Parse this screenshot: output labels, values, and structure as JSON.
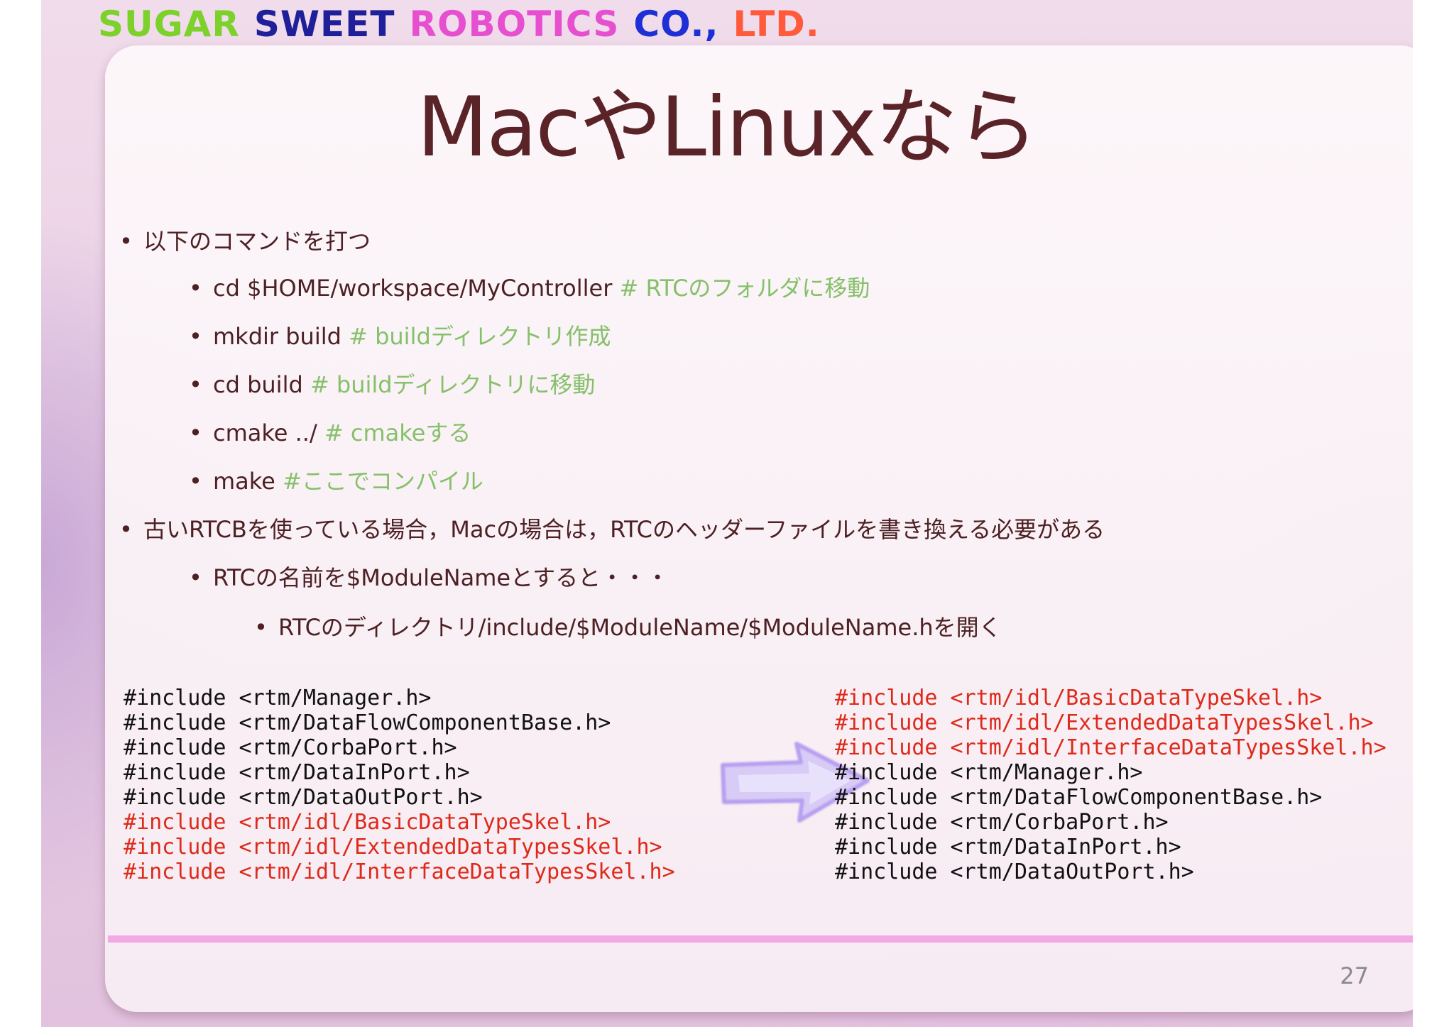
{
  "header": {
    "brand_words": [
      {
        "text": "SUGAR",
        "color": "#7cd12b"
      },
      {
        "text": "SWEET",
        "color": "#1f1f9a"
      },
      {
        "text": "ROBOTICS",
        "color": "#e64fd0"
      },
      {
        "text": "CO.,",
        "color": "#1e2fd6"
      },
      {
        "text": "LTD.",
        "color": "#ff5a3c"
      }
    ]
  },
  "slide": {
    "title": "MacやLinuxなら",
    "page_number": "27"
  },
  "bullets": [
    {
      "level": 1,
      "text": "以下のコマンドを打つ",
      "comment": ""
    },
    {
      "level": 2,
      "text": "cd $HOME/workspace/MyController ",
      "comment": "# RTCのフォルダに移動"
    },
    {
      "level": 2,
      "text": "mkdir build    ",
      "comment": "# buildディレクトリ作成"
    },
    {
      "level": 2,
      "text": "cd build ",
      "comment": "# buildディレクトリに移動"
    },
    {
      "level": 2,
      "text": "cmake ../ ",
      "comment": "# cmakeする"
    },
    {
      "level": 2,
      "text": "make  ",
      "comment": "#ここでコンパイル"
    },
    {
      "level": 1,
      "text": "古いRTCBを使っている場合，Macの場合は，RTCのヘッダーファイルを書き換える必要がある",
      "comment": ""
    },
    {
      "level": 2,
      "text": "RTCの名前を$ModuleNameとすると・・・",
      "comment": ""
    },
    {
      "level": 3,
      "text": "RTCのディレクトリ/include/$ModuleName/$ModuleName.hを開く",
      "comment": ""
    }
  ],
  "code_before": [
    {
      "text": "#include <rtm/Manager.h>",
      "highlight": false
    },
    {
      "text": "#include <rtm/DataFlowComponentBase.h>",
      "highlight": false
    },
    {
      "text": "#include <rtm/CorbaPort.h>",
      "highlight": false
    },
    {
      "text": "#include <rtm/DataInPort.h>",
      "highlight": false
    },
    {
      "text": "#include <rtm/DataOutPort.h>",
      "highlight": false
    },
    {
      "text": "#include <rtm/idl/BasicDataTypeSkel.h>",
      "highlight": true
    },
    {
      "text": "#include <rtm/idl/ExtendedDataTypesSkel.h>",
      "highlight": true
    },
    {
      "text": "#include <rtm/idl/InterfaceDataTypesSkel.h>",
      "highlight": true
    }
  ],
  "code_after": [
    {
      "text": "#include <rtm/idl/BasicDataTypeSkel.h>",
      "highlight": true
    },
    {
      "text": "#include <rtm/idl/ExtendedDataTypesSkel.h>",
      "highlight": true
    },
    {
      "text": "#include <rtm/idl/InterfaceDataTypesSkel.h>",
      "highlight": true
    },
    {
      "text": "#include <rtm/Manager.h>",
      "highlight": false
    },
    {
      "text": "#include <rtm/DataFlowComponentBase.h>",
      "highlight": false
    },
    {
      "text": "#include <rtm/CorbaPort.h>",
      "highlight": false
    },
    {
      "text": "#include <rtm/DataInPort.h>",
      "highlight": false
    },
    {
      "text": "#include <rtm/DataOutPort.h>",
      "highlight": false
    }
  ],
  "colors": {
    "title": "#5a2327",
    "comment": "#86c06a",
    "highlight": "#dd2a1a",
    "bar": "#f3a8e6",
    "arrow": "#c9b6f2"
  },
  "icons": {
    "arrow": "right-arrow-icon"
  }
}
